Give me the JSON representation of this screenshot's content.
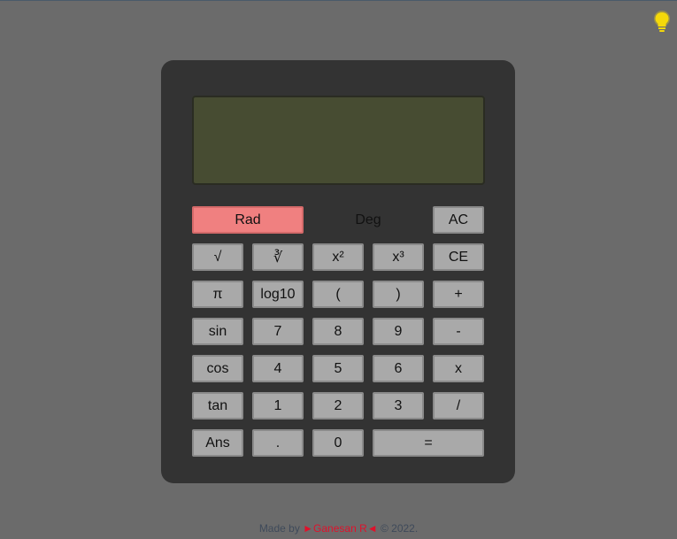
{
  "display": {
    "value": ""
  },
  "modes": {
    "rad_label": "Rad",
    "deg_label": "Deg"
  },
  "keys": {
    "ac": "AC",
    "sqrt": "√",
    "cbrt": "∛",
    "square": "x²",
    "cube": "x³",
    "ce": "CE",
    "pi": "π",
    "log10": "log10",
    "lparen": "(",
    "rparen": ")",
    "plus": "+",
    "sin": "sin",
    "seven": "7",
    "eight": "8",
    "nine": "9",
    "minus": "-",
    "cos": "cos",
    "four": "4",
    "five": "5",
    "six": "6",
    "multiply": "x",
    "tan": "tan",
    "one": "1",
    "two": "2",
    "three": "3",
    "divide": "/",
    "ans": "Ans",
    "dot": ".",
    "zero": "0",
    "equals": "="
  },
  "footer": {
    "made_by": "Made by ",
    "author": "►Ganesan R◄",
    "copyright": " © 2022."
  },
  "colors": {
    "background": "#6b6b6b",
    "calculator_body": "#333333",
    "display": "#474c32",
    "key": "#a9a9a9",
    "rad_active": "#f08080",
    "author": "#e0112b",
    "bulb": "#f5d90a"
  },
  "icons": {
    "theme_toggle": "lightbulb-icon"
  }
}
